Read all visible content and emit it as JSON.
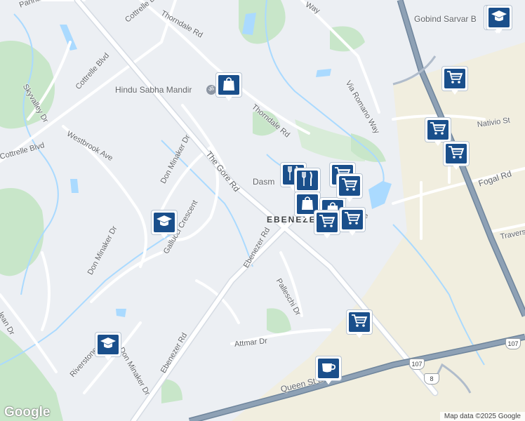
{
  "map": {
    "streets": [
      {
        "id": "pannahill",
        "name": "Panna"
      },
      {
        "id": "cottrelle-1",
        "name": "Cottrelle Blvd"
      },
      {
        "id": "cottrelle-2",
        "name": "Cottrelle Blvd"
      },
      {
        "id": "cottrelle-3",
        "name": "Cottrelle Blvd"
      },
      {
        "id": "thorndale-1",
        "name": "Thorndale Rd"
      },
      {
        "id": "thorndale-2",
        "name": "Thorndale Rd"
      },
      {
        "id": "way-top",
        "name": "Way"
      },
      {
        "id": "skyvalley",
        "name": "Skyvalley Dr"
      },
      {
        "id": "westbrook",
        "name": "Westbrook Ave"
      },
      {
        "id": "gore",
        "name": "The Gore Rd"
      },
      {
        "id": "don-minaker-1",
        "name": "Don Minaker Dr"
      },
      {
        "id": "don-minaker-2",
        "name": "Don Minaker Dr"
      },
      {
        "id": "don-minaker-3",
        "name": "Don Minaker Dr"
      },
      {
        "id": "gallucci",
        "name": "Gallucci Crescent"
      },
      {
        "id": "via-romano",
        "name": "Via Romano Way"
      },
      {
        "id": "nativio",
        "name": "Nativio St"
      },
      {
        "id": "fogal",
        "name": "Fogal Rd"
      },
      {
        "id": "travers",
        "name": "Travers"
      },
      {
        "id": "dasm",
        "name": "Dasm"
      },
      {
        "id": "ebenezer-1",
        "name": "Ebenezer Rd"
      },
      {
        "id": "ebenezer-2",
        "name": "Ebenezer Rd"
      },
      {
        "id": "palleschi",
        "name": "Palleschi Dr"
      },
      {
        "id": "attmar",
        "name": "Attmar Dr"
      },
      {
        "id": "riverstone",
        "name": "Riverstone"
      },
      {
        "id": "queen",
        "name": "Queen St E"
      },
      {
        "id": "mclean",
        "name": "lean Dr"
      },
      {
        "id": "ne",
        "name": "ne"
      }
    ],
    "area_label": "EBENEZER",
    "places": [
      {
        "id": "hindu-sabha",
        "name": "Hindu Sabha Mandir"
      },
      {
        "id": "gobind-sarvar",
        "name": "Gobind Sarvar B"
      }
    ],
    "highway_shields": [
      "107",
      "107",
      "8"
    ],
    "pins": [
      {
        "id": "pin-1",
        "icon": "graduation-cap-icon"
      },
      {
        "id": "pin-2",
        "icon": "shopping-bag-icon"
      },
      {
        "id": "pin-3",
        "icon": "graduation-cap-icon"
      },
      {
        "id": "pin-4",
        "icon": "shopping-cart-icon"
      },
      {
        "id": "pin-5",
        "icon": "shopping-cart-icon"
      },
      {
        "id": "pin-6",
        "icon": "shopping-cart-icon"
      },
      {
        "id": "pin-7",
        "icon": "fork-knife-icon"
      },
      {
        "id": "pin-8",
        "icon": "fork-knife-icon"
      },
      {
        "id": "pin-9",
        "icon": "shopping-cart-icon"
      },
      {
        "id": "pin-10",
        "icon": "shopping-bag-icon"
      },
      {
        "id": "pin-11",
        "icon": "shopping-bag-icon"
      },
      {
        "id": "pin-12",
        "icon": "shopping-cart-icon"
      },
      {
        "id": "pin-13",
        "icon": "shopping-cart-icon"
      },
      {
        "id": "pin-14",
        "icon": "shopping-cart-icon"
      },
      {
        "id": "pin-15",
        "icon": "graduation-cap-icon"
      },
      {
        "id": "pin-16",
        "icon": "graduation-cap-icon"
      },
      {
        "id": "pin-17",
        "icon": "shopping-cart-icon"
      },
      {
        "id": "pin-18",
        "icon": "coffee-cup-icon"
      }
    ],
    "logo": "Google",
    "attribution": "Map data ©2025 Google",
    "colors": {
      "background": "#eceff3",
      "park": "#c8e6c9",
      "water": "#aadaff",
      "highway": "#8ea1b5",
      "pin": "#1a4f8b",
      "commercial": "#f1eedf"
    }
  }
}
